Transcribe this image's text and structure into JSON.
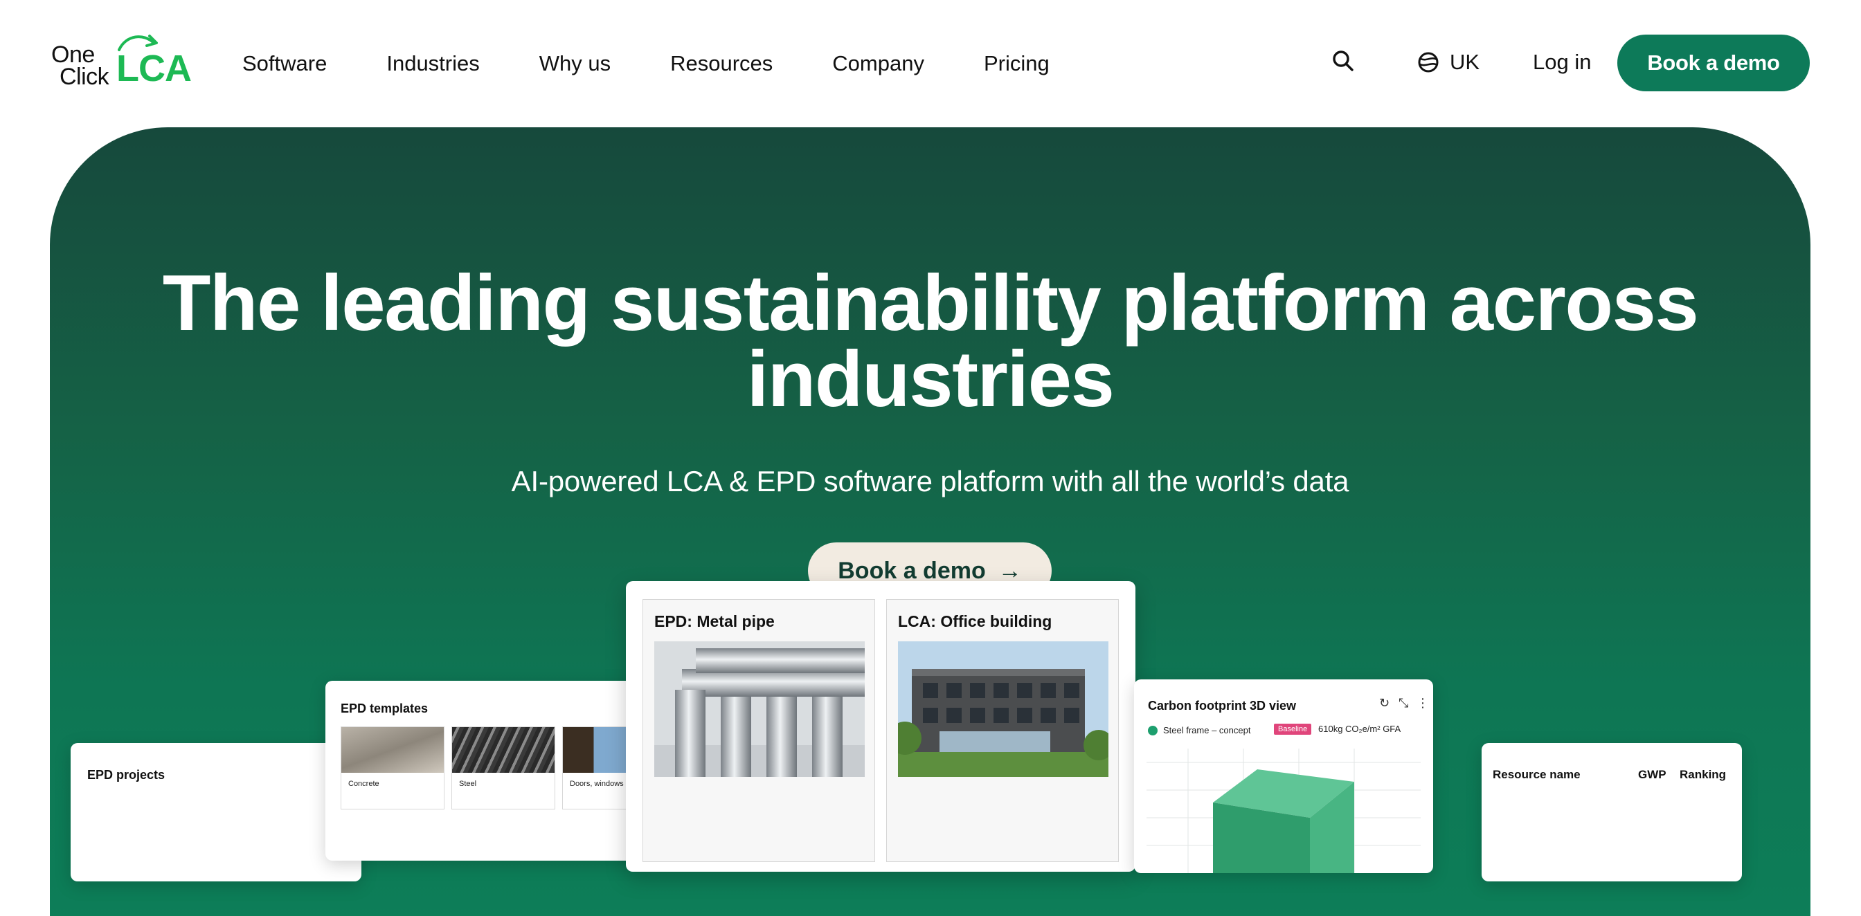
{
  "logo": {
    "word1": "One",
    "word2": "Click",
    "mark": "LCA"
  },
  "nav": {
    "items": [
      "Software",
      "Industries",
      "Why us",
      "Resources",
      "Company",
      "Pricing"
    ],
    "search_icon": "search-icon",
    "locale_label": "UK",
    "login_label": "Log in",
    "cta_label": "Book a demo"
  },
  "hero": {
    "title": "The leading sustainability platform across industries",
    "subtitle": "AI-powered LCA & EPD software platform with all the world’s data",
    "cta_label": "Book a demo",
    "cta_arrow": "→"
  },
  "cards": {
    "epd_projects": {
      "title": "EPD projects"
    },
    "epd_templates": {
      "title": "EPD templates",
      "items": [
        "Concrete",
        "Steel",
        "Doors, windows a"
      ]
    },
    "epd_panel": {
      "title": "EPD: Metal pipe"
    },
    "lca_panel": {
      "title": "LCA: Office building"
    },
    "carbon": {
      "title": "Carbon footprint 3D view",
      "legend": "Steel frame – concept",
      "badge": "Baseline",
      "value": "610kg CO₂e/m² GFA"
    },
    "resources": {
      "col1": "Resource name",
      "col2": "GWP",
      "col3": "Ranking"
    }
  },
  "colors": {
    "brand_green": "#0d7a59",
    "logo_green": "#1db954",
    "hero_top": "#16493c",
    "hero_bottom": "#0d7e58",
    "cream": "#f2ebe1",
    "badge_pink": "#e0457b"
  }
}
